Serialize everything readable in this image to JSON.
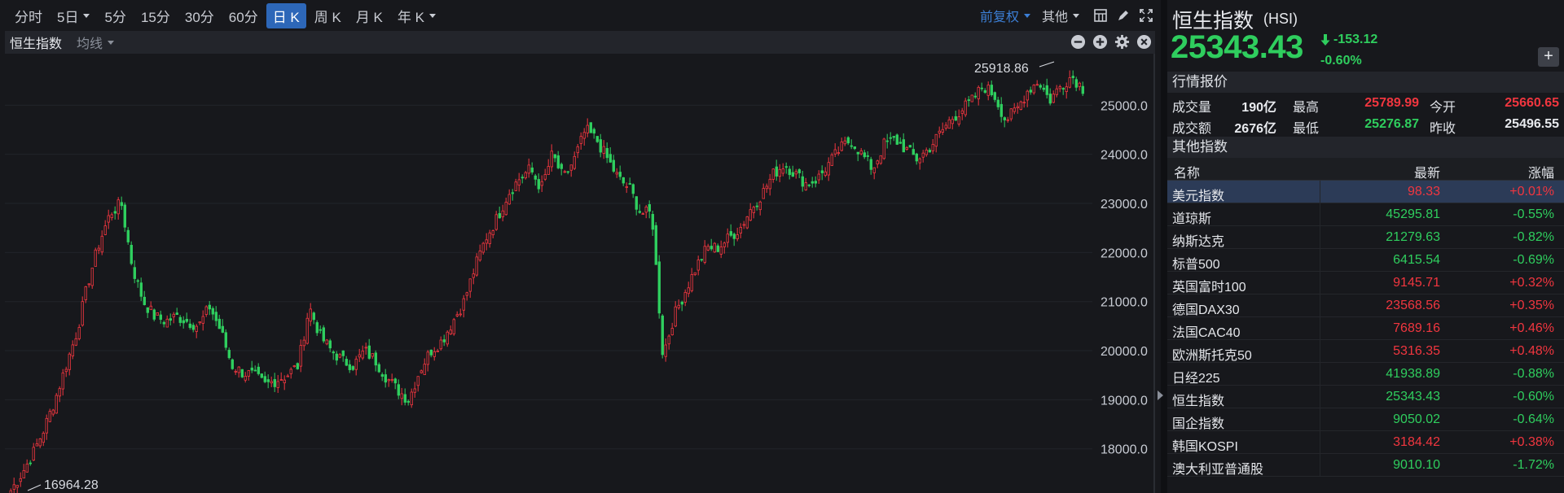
{
  "toolbar": {
    "periods": [
      {
        "label": "分时",
        "caret": false,
        "active": false
      },
      {
        "label": "5日",
        "caret": true,
        "active": false
      },
      {
        "label": "5分",
        "caret": false,
        "active": false
      },
      {
        "label": "15分",
        "caret": false,
        "active": false
      },
      {
        "label": "30分",
        "caret": false,
        "active": false
      },
      {
        "label": "60分",
        "caret": false,
        "active": false
      },
      {
        "label": "日 K",
        "caret": false,
        "active": true
      },
      {
        "label": "周 K",
        "caret": false,
        "active": false
      },
      {
        "label": "月 K",
        "caret": false,
        "active": false
      },
      {
        "label": "年 K",
        "caret": true,
        "active": false
      }
    ],
    "adjust_label": "前复权",
    "other_label": "其他"
  },
  "subbar": {
    "title": "恒生指数",
    "ma_label": "均线"
  },
  "chart_data": {
    "type": "candlestick",
    "y_ticks": [
      "25000.0",
      "24000.0",
      "23000.0",
      "22000.0",
      "21000.0",
      "20000.0",
      "19000.0",
      "18000.0"
    ],
    "ylim": [
      17100,
      26050
    ],
    "high_annotation": "25918.86",
    "low_annotation": "16964.28",
    "up_color": "#f1363f",
    "down_color": "#2fce5e",
    "close_trend": [
      17150,
      17500,
      17900,
      18400,
      19000,
      19700,
      20400,
      21400,
      22200,
      22800,
      23000,
      21700,
      21000,
      20700,
      20600,
      20700,
      20600,
      20500,
      20900,
      20400,
      19700,
      19550,
      19500,
      19300,
      19400,
      19500,
      19700,
      20900,
      20300,
      20000,
      19800,
      19700,
      20000,
      19800,
      19450,
      19200,
      19000,
      19600,
      20000,
      20200,
      20600,
      21000,
      21700,
      22300,
      22700,
      23200,
      23500,
      23700,
      23300,
      24000,
      23500,
      23900,
      24500,
      24300,
      23900,
      23500,
      23300,
      22800,
      22800,
      19900,
      20700,
      21200,
      21700,
      22100,
      22100,
      22300,
      22500,
      22900,
      23200,
      23600,
      23800,
      23600,
      23400,
      23500,
      23800,
      24100,
      24300,
      24000,
      23700,
      24200,
      24300,
      24100,
      23900,
      24100,
      24400,
      24700,
      24900,
      25100,
      25400,
      25200,
      24700,
      24900,
      25300,
      25500,
      25100,
      25400,
      25600,
      25343
    ]
  },
  "panel": {
    "name": "恒生指数",
    "code": "(HSI)",
    "price": "25343.43",
    "change": "-153.12",
    "percent": "-0.60%",
    "quote_section": "行情报价",
    "quotes": {
      "volume_label": "成交量",
      "volume": "190亿",
      "high_label": "最高",
      "high": "25789.99",
      "open_label": "今开",
      "open": "25660.65",
      "amount_label": "成交额",
      "amount": "2676亿",
      "low_label": "最低",
      "low": "25276.87",
      "prev_label": "昨收",
      "prev": "25496.55"
    },
    "other_section": "其他指数",
    "table_head": {
      "name": "名称",
      "latest": "最新",
      "change": "涨幅"
    },
    "rows": [
      {
        "name": "美元指数",
        "latest": "98.33",
        "change": "+0.01%",
        "dir": "up",
        "selected": true
      },
      {
        "name": "道琼斯",
        "latest": "45295.81",
        "change": "-0.55%",
        "dir": "down",
        "selected": false
      },
      {
        "name": "纳斯达克",
        "latest": "21279.63",
        "change": "-0.82%",
        "dir": "down",
        "selected": false
      },
      {
        "name": "标普500",
        "latest": "6415.54",
        "change": "-0.69%",
        "dir": "down",
        "selected": false
      },
      {
        "name": "英国富时100",
        "latest": "9145.71",
        "change": "+0.32%",
        "dir": "up",
        "selected": false
      },
      {
        "name": "德国DAX30",
        "latest": "23568.56",
        "change": "+0.35%",
        "dir": "up",
        "selected": false
      },
      {
        "name": "法国CAC40",
        "latest": "7689.16",
        "change": "+0.46%",
        "dir": "up",
        "selected": false
      },
      {
        "name": "欧洲斯托克50",
        "latest": "5316.35",
        "change": "+0.48%",
        "dir": "up",
        "selected": false
      },
      {
        "name": "日经225",
        "latest": "41938.89",
        "change": "-0.88%",
        "dir": "down",
        "selected": false
      },
      {
        "name": "恒生指数",
        "latest": "25343.43",
        "change": "-0.60%",
        "dir": "down",
        "selected": false
      },
      {
        "name": "国企指数",
        "latest": "9050.02",
        "change": "-0.64%",
        "dir": "down",
        "selected": false
      },
      {
        "name": "韩国KOSPI",
        "latest": "3184.42",
        "change": "+0.38%",
        "dir": "up",
        "selected": false
      },
      {
        "name": "澳大利亚普通股",
        "latest": "9010.10",
        "change": "-1.72%",
        "dir": "down",
        "selected": false
      }
    ]
  }
}
